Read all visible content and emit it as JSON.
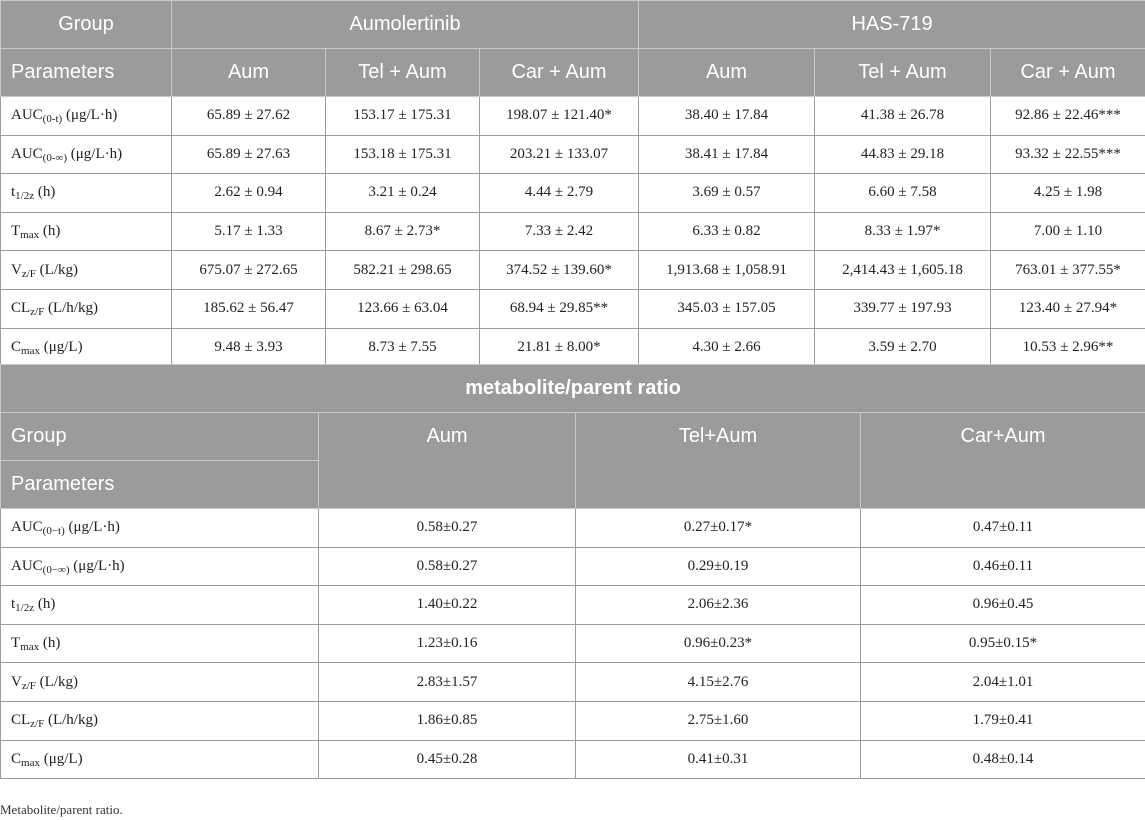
{
  "table1": {
    "group_label": "Group",
    "parameters_label": "Parameters",
    "drug_groups": [
      "Aumolertinib",
      "HAS-719"
    ],
    "subgroups": [
      "Aum",
      "Tel + Aum",
      "Car + Aum",
      "Aum",
      "Tel + Aum",
      "Car + Aum"
    ],
    "rows": [
      {
        "param_main": "AUC",
        "param_sub": "(0-t)",
        "param_unit": " (μg/L·h)",
        "values": [
          "65.89 ± 27.62",
          "153.17 ± 175.31",
          "198.07 ± 121.40*",
          "38.40 ± 17.84",
          "41.38 ± 26.78",
          "92.86 ± 22.46***"
        ]
      },
      {
        "param_main": "AUC",
        "param_sub": "(0-∞)",
        "param_unit": " (μg/L·h)",
        "values": [
          "65.89 ± 27.63",
          "153.18 ± 175.31",
          "203.21 ± 133.07",
          "38.41 ± 17.84",
          "44.83 ± 29.18",
          "93.32 ± 22.55***"
        ]
      },
      {
        "param_main": "t",
        "param_sub": "1/2z",
        "param_unit": " (h)",
        "values": [
          "2.62 ± 0.94",
          "3.21 ± 0.24",
          "4.44 ± 2.79",
          "3.69 ± 0.57",
          "6.60 ± 7.58",
          "4.25 ± 1.98"
        ]
      },
      {
        "param_main": "T",
        "param_sub": "max",
        "param_unit": " (h)",
        "values": [
          "5.17 ± 1.33",
          "8.67 ± 2.73*",
          "7.33 ± 2.42",
          "6.33 ± 0.82",
          "8.33 ± 1.97*",
          "7.00 ± 1.10"
        ]
      },
      {
        "param_main": "V",
        "param_sub": "z/F",
        "param_unit": " (L/kg)",
        "values": [
          "675.07 ± 272.65",
          "582.21 ± 298.65",
          "374.52 ± 139.60*",
          "1,913.68 ± 1,058.91",
          "2,414.43 ± 1,605.18",
          "763.01 ± 377.55*"
        ]
      },
      {
        "param_main": "CL",
        "param_sub": "z/F",
        "param_unit": " (L/h/kg)",
        "values": [
          "185.62 ± 56.47",
          "123.66 ± 63.04",
          "68.94 ± 29.85**",
          "345.03 ± 157.05",
          "339.77 ± 197.93",
          "123.40 ± 27.94*"
        ]
      },
      {
        "param_main": "C",
        "param_sub": "max",
        "param_unit": " (μg/L)",
        "values": [
          "9.48 ± 3.93",
          "8.73 ± 7.55",
          "21.81 ± 8.00*",
          "4.30 ± 2.66",
          "3.59 ± 2.70",
          "10.53 ± 2.96**"
        ]
      }
    ]
  },
  "table2": {
    "title": "metabolite/parent ratio",
    "group_label": "Group",
    "parameters_label": "Parameters",
    "subgroups": [
      "Aum",
      "Tel+Aum",
      "Car+Aum"
    ],
    "rows": [
      {
        "param_main": "AUC",
        "param_sub": "(0−t)",
        "param_unit": " (μg/L·h)",
        "values": [
          "0.58±0.27",
          "0.27±0.17*",
          "0.47±0.11"
        ]
      },
      {
        "param_main": "AUC",
        "param_sub": "(0−∞)",
        "param_unit": " (μg/L·h)",
        "values": [
          "0.58±0.27",
          "0.29±0.19",
          "0.46±0.11"
        ]
      },
      {
        "param_main": "t",
        "param_sub": "1/2z",
        "param_unit": " (h)",
        "values": [
          "1.40±0.22",
          "2.06±2.36",
          "0.96±0.45"
        ]
      },
      {
        "param_main": "T",
        "param_sub": "max",
        "param_unit": " (h)",
        "values": [
          "1.23±0.16",
          "0.96±0.23*",
          "0.95±0.15*"
        ]
      },
      {
        "param_main": "V",
        "param_sub": "z/F",
        "param_unit": " (L/kg)",
        "values": [
          "2.83±1.57",
          "4.15±2.76",
          "2.04±1.01"
        ]
      },
      {
        "param_main": "CL",
        "param_sub": "z/F",
        "param_unit": " (L/h/kg)",
        "values": [
          "1.86±0.85",
          "2.75±1.60",
          "1.79±0.41"
        ]
      },
      {
        "param_main": "C",
        "param_sub": "max",
        "param_unit": " (μg/L)",
        "values": [
          "0.45±0.28",
          "0.41±0.31",
          "0.48±0.14"
        ]
      }
    ]
  },
  "footnote": "Metabolite/parent ratio.",
  "colors": {
    "header_bg": "#9b9b9b",
    "header_text": "#ffffff",
    "border": "#9b9b9b"
  }
}
